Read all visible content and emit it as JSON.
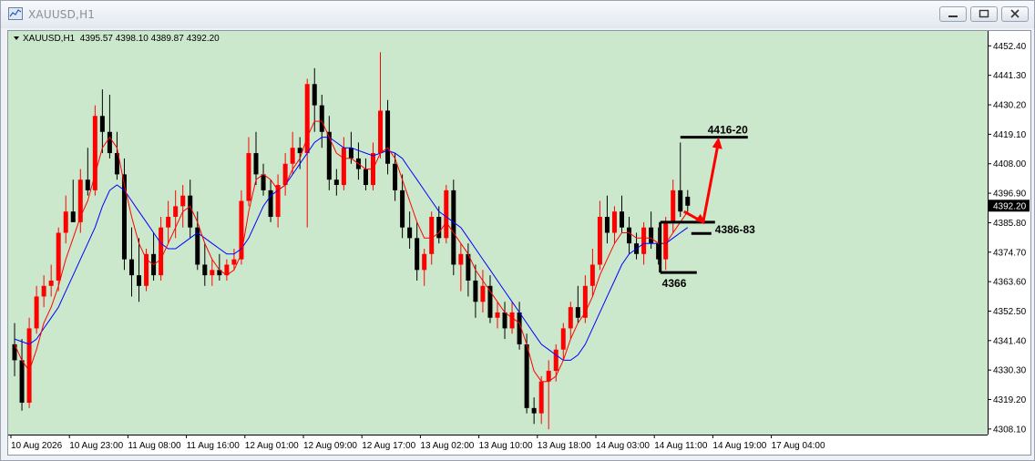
{
  "window": {
    "title": "XAUUSD,H1",
    "app_icon": "chart-window-icon",
    "controls": [
      "minimize-icon",
      "maximize-icon",
      "close-icon"
    ]
  },
  "colors": {
    "chart_background": "#cce8cc",
    "bull_candle": "#ff0000",
    "bear_candle": "#000000",
    "ma_fast": "#ff0000",
    "ma_slow": "#0000ff",
    "annotation": "#ff0000"
  },
  "chart_header": "XAUUSD,H1  4395.57 4398.10 4389.87 4392.20",
  "current_price_label": "4392.20",
  "chart_data": {
    "type": "candlestick",
    "symbol": "XAUUSD",
    "timeframe": "H1",
    "ylim": [
      4306,
      4458
    ],
    "y_ticks": [
      "4452.40",
      "4441.30",
      "4430.20",
      "4419.10",
      "4408.00",
      "4396.90",
      "4385.80",
      "4374.70",
      "4363.60",
      "4352.50",
      "4341.40",
      "4330.30",
      "4319.20",
      "4308.10"
    ],
    "x_ticks": [
      "10 Aug 2026",
      "10 Aug 23:00",
      "11 Aug 08:00",
      "11 Aug 16:00",
      "12 Aug 01:00",
      "12 Aug 09:00",
      "12 Aug 17:00",
      "13 Aug 02:00",
      "13 Aug 10:00",
      "13 Aug 18:00",
      "14 Aug 03:00",
      "14 Aug 11:00",
      "14 Aug 19:00",
      "17 Aug 04:00"
    ],
    "grid": false,
    "ohlc": [
      [
        4340,
        4348,
        4328,
        4334
      ],
      [
        4334,
        4342,
        4315,
        4318
      ],
      [
        4318,
        4350,
        4316,
        4346
      ],
      [
        4346,
        4362,
        4344,
        4358
      ],
      [
        4358,
        4366,
        4354,
        4362
      ],
      [
        4362,
        4370,
        4358,
        4364
      ],
      [
        4364,
        4384,
        4360,
        4382
      ],
      [
        4382,
        4396,
        4378,
        4390
      ],
      [
        4390,
        4402,
        4386,
        4386
      ],
      [
        4386,
        4406,
        4382,
        4402
      ],
      [
        4402,
        4414,
        4396,
        4398
      ],
      [
        4398,
        4430,
        4396,
        4426
      ],
      [
        4426,
        4436,
        4412,
        4420
      ],
      [
        4420,
        4434,
        4410,
        4412
      ],
      [
        4412,
        4420,
        4402,
        4404
      ],
      [
        4404,
        4410,
        4368,
        4372
      ],
      [
        4372,
        4384,
        4358,
        4366
      ],
      [
        4366,
        4380,
        4356,
        4362
      ],
      [
        4362,
        4376,
        4360,
        4374
      ],
      [
        4374,
        4382,
        4364,
        4366
      ],
      [
        4366,
        4388,
        4364,
        4384
      ],
      [
        4384,
        4394,
        4378,
        4388
      ],
      [
        4388,
        4398,
        4380,
        4392
      ],
      [
        4392,
        4400,
        4384,
        4396
      ],
      [
        4396,
        4402,
        4380,
        4384
      ],
      [
        4384,
        4390,
        4368,
        4370
      ],
      [
        4370,
        4378,
        4362,
        4366
      ],
      [
        4366,
        4372,
        4362,
        4368
      ],
      [
        4368,
        4374,
        4364,
        4366
      ],
      [
        4366,
        4372,
        4364,
        4370
      ],
      [
        4370,
        4376,
        4368,
        4372
      ],
      [
        4372,
        4398,
        4370,
        4394
      ],
      [
        4394,
        4418,
        4392,
        4412
      ],
      [
        4412,
        4420,
        4400,
        4404
      ],
      [
        4404,
        4408,
        4396,
        4398
      ],
      [
        4398,
        4402,
        4386,
        4388
      ],
      [
        4388,
        4404,
        4384,
        4400
      ],
      [
        4400,
        4412,
        4396,
        4408
      ],
      [
        4408,
        4420,
        4404,
        4414
      ],
      [
        4414,
        4418,
        4406,
        4412
      ],
      [
        4412,
        4440,
        4384,
        4438
      ],
      [
        4438,
        4444,
        4420,
        4430
      ],
      [
        4430,
        4434,
        4414,
        4420
      ],
      [
        4420,
        4426,
        4398,
        4402
      ],
      [
        4402,
        4406,
        4396,
        4400
      ],
      [
        4400,
        4418,
        4398,
        4414
      ],
      [
        4414,
        4420,
        4408,
        4410
      ],
      [
        4410,
        4416,
        4402,
        4406
      ],
      [
        4406,
        4410,
        4398,
        4400
      ],
      [
        4400,
        4416,
        4398,
        4412
      ],
      [
        4412,
        4450,
        4410,
        4428
      ],
      [
        4428,
        4432,
        4404,
        4408
      ],
      [
        4408,
        4412,
        4394,
        4398
      ],
      [
        4398,
        4404,
        4380,
        4384
      ],
      [
        4384,
        4390,
        4376,
        4380
      ],
      [
        4380,
        4386,
        4364,
        4368
      ],
      [
        4368,
        4376,
        4362,
        4374
      ],
      [
        4374,
        4390,
        4370,
        4388
      ],
      [
        4388,
        4392,
        4378,
        4380
      ],
      [
        4380,
        4400,
        4378,
        4398
      ],
      [
        4398,
        4402,
        4366,
        4370
      ],
      [
        4370,
        4378,
        4360,
        4374
      ],
      [
        4374,
        4378,
        4358,
        4364
      ],
      [
        4364,
        4370,
        4350,
        4356
      ],
      [
        4356,
        4368,
        4352,
        4362
      ],
      [
        4362,
        4366,
        4348,
        4350
      ],
      [
        4350,
        4356,
        4346,
        4352
      ],
      [
        4352,
        4356,
        4342,
        4346
      ],
      [
        4346,
        4356,
        4344,
        4352
      ],
      [
        4352,
        4356,
        4338,
        4340
      ],
      [
        4340,
        4344,
        4314,
        4316
      ],
      [
        4316,
        4320,
        4310,
        4314
      ],
      [
        4314,
        4328,
        4310,
        4326
      ],
      [
        4326,
        4334,
        4308,
        4330
      ],
      [
        4330,
        4340,
        4326,
        4338
      ],
      [
        4338,
        4348,
        4334,
        4346
      ],
      [
        4346,
        4356,
        4342,
        4354
      ],
      [
        4354,
        4362,
        4348,
        4350
      ],
      [
        4350,
        4366,
        4348,
        4362
      ],
      [
        4362,
        4376,
        4358,
        4370
      ],
      [
        4370,
        4394,
        4368,
        4388
      ],
      [
        4388,
        4396,
        4378,
        4382
      ],
      [
        4382,
        4392,
        4378,
        4390
      ],
      [
        4390,
        4396,
        4382,
        4384
      ],
      [
        4384,
        4388,
        4374,
        4378
      ],
      [
        4378,
        4382,
        4372,
        4374
      ],
      [
        4374,
        4386,
        4370,
        4384
      ],
      [
        4384,
        4390,
        4376,
        4378
      ],
      [
        4378,
        4384,
        4370,
        4372
      ],
      [
        4372,
        4388,
        4368,
        4386
      ],
      [
        4386,
        4402,
        4382,
        4398
      ],
      [
        4398,
        4416,
        4388,
        4390
      ],
      [
        4395.57,
        4398.1,
        4389.87,
        4392.2
      ]
    ],
    "ma_fast": {
      "color": "#ff0000",
      "values": [
        4340,
        4334,
        4330,
        4338,
        4348,
        4354,
        4362,
        4372,
        4380,
        4388,
        4394,
        4404,
        4414,
        4418,
        4414,
        4400,
        4388,
        4378,
        4372,
        4370,
        4372,
        4378,
        4384,
        4390,
        4392,
        4386,
        4378,
        4372,
        4368,
        4366,
        4368,
        4374,
        4390,
        4402,
        4404,
        4402,
        4398,
        4400,
        4406,
        4410,
        4418,
        4424,
        4424,
        4418,
        4412,
        4410,
        4410,
        4408,
        4406,
        4406,
        4412,
        4414,
        4410,
        4402,
        4394,
        4386,
        4380,
        4380,
        4382,
        4386,
        4382,
        4378,
        4374,
        4368,
        4364,
        4360,
        4356,
        4352,
        4350,
        4348,
        4340,
        4330,
        4326,
        4326,
        4328,
        4334,
        4342,
        4348,
        4352,
        4358,
        4366,
        4372,
        4378,
        4382,
        4382,
        4380,
        4380,
        4380,
        4378,
        4378,
        4382,
        4386,
        4390
      ]
    },
    "ma_slow": {
      "color": "#0000ff",
      "values": [
        4342,
        4341,
        4340,
        4342,
        4346,
        4350,
        4354,
        4360,
        4366,
        4372,
        4378,
        4384,
        4392,
        4398,
        4400,
        4398,
        4394,
        4390,
        4386,
        4382,
        4378,
        4376,
        4376,
        4378,
        4380,
        4382,
        4380,
        4378,
        4376,
        4374,
        4374,
        4376,
        4380,
        4386,
        4392,
        4396,
        4398,
        4400,
        4404,
        4408,
        4412,
        4416,
        4418,
        4418,
        4416,
        4414,
        4414,
        4413,
        4412,
        4411,
        4412,
        4413,
        4412,
        4410,
        4406,
        4402,
        4398,
        4394,
        4390,
        4388,
        4386,
        4384,
        4380,
        4376,
        4372,
        4368,
        4364,
        4360,
        4356,
        4352,
        4348,
        4344,
        4340,
        4338,
        4336,
        4334,
        4334,
        4336,
        4340,
        4346,
        4352,
        4358,
        4364,
        4370,
        4374,
        4376,
        4378,
        4378,
        4378,
        4378,
        4380,
        4382,
        4384
      ]
    },
    "annotations": {
      "target_label": "4416-20",
      "target_price": 4418,
      "resistance_label": "4386-83",
      "resistance_price": 4384.5,
      "support_label": "4366",
      "support_price": 4366,
      "box_top_price": 4386,
      "arrow_path_prices": [
        4390,
        4386,
        4418
      ]
    }
  }
}
